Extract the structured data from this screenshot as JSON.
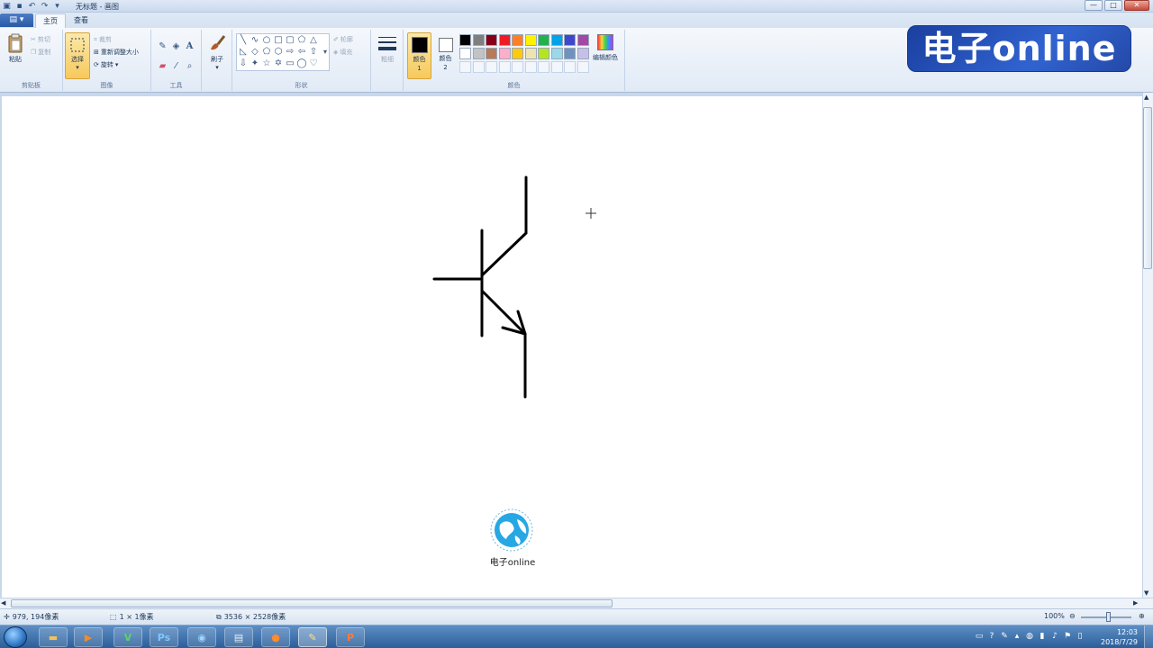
{
  "window": {
    "title": "无标题 - 画图",
    "controls": {
      "minimize": "—",
      "maximize": "□",
      "close": "✕"
    }
  },
  "quick_access": [
    "app-menu-icon",
    "save-icon",
    "undo-icon",
    "redo-icon",
    "customize-icon"
  ],
  "tabs": {
    "file": "▤ ▾",
    "home": "主页",
    "view": "查看"
  },
  "ribbon": {
    "clipboard": {
      "paste": "粘贴",
      "cut": "剪切",
      "copy": "复制",
      "label": "剪贴板"
    },
    "image": {
      "select": "选择",
      "crop": "裁剪",
      "resize": "重新调整大小",
      "rotate": "旋转",
      "label": "图像"
    },
    "tools": {
      "label": "工具",
      "text_tool": "A"
    },
    "brushes": {
      "label": "刷子"
    },
    "shapes": {
      "outline": "轮廓",
      "fill": "填充",
      "label": "形状"
    },
    "size": {
      "label": "粗细"
    },
    "colors": {
      "color1": "颜色 1",
      "color2": "颜色 2",
      "edit": "编辑颜色",
      "label": "颜色",
      "palette_row1": [
        "#000000",
        "#7f7f7f",
        "#880015",
        "#ed1c24",
        "#ff7f27",
        "#fff200",
        "#22b14c",
        "#00a2e8",
        "#3f48cc",
        "#a349a4"
      ],
      "palette_row2": [
        "#ffffff",
        "#c3c3c3",
        "#b97a57",
        "#ffaec9",
        "#ffc90e",
        "#efe4b0",
        "#b5e61d",
        "#99d9ea",
        "#7092be",
        "#c8bfe7"
      ]
    }
  },
  "watermark": "电子online",
  "canvas": {
    "drawing": "npn-transistor-symbol",
    "logo_caption": "电子online"
  },
  "statusbar": {
    "cursor": "979, 194像素",
    "selection": "1 × 1像素",
    "size": "3536 × 2528像素",
    "zoom": "100%"
  },
  "taskbar": {
    "apps": [
      "explorer",
      "media-player",
      "v-app",
      "photoshop",
      "baidu-app",
      "notepad",
      "firefox",
      "paint",
      "powerpoint"
    ],
    "time": "12:03",
    "date": "2018/7/29"
  }
}
